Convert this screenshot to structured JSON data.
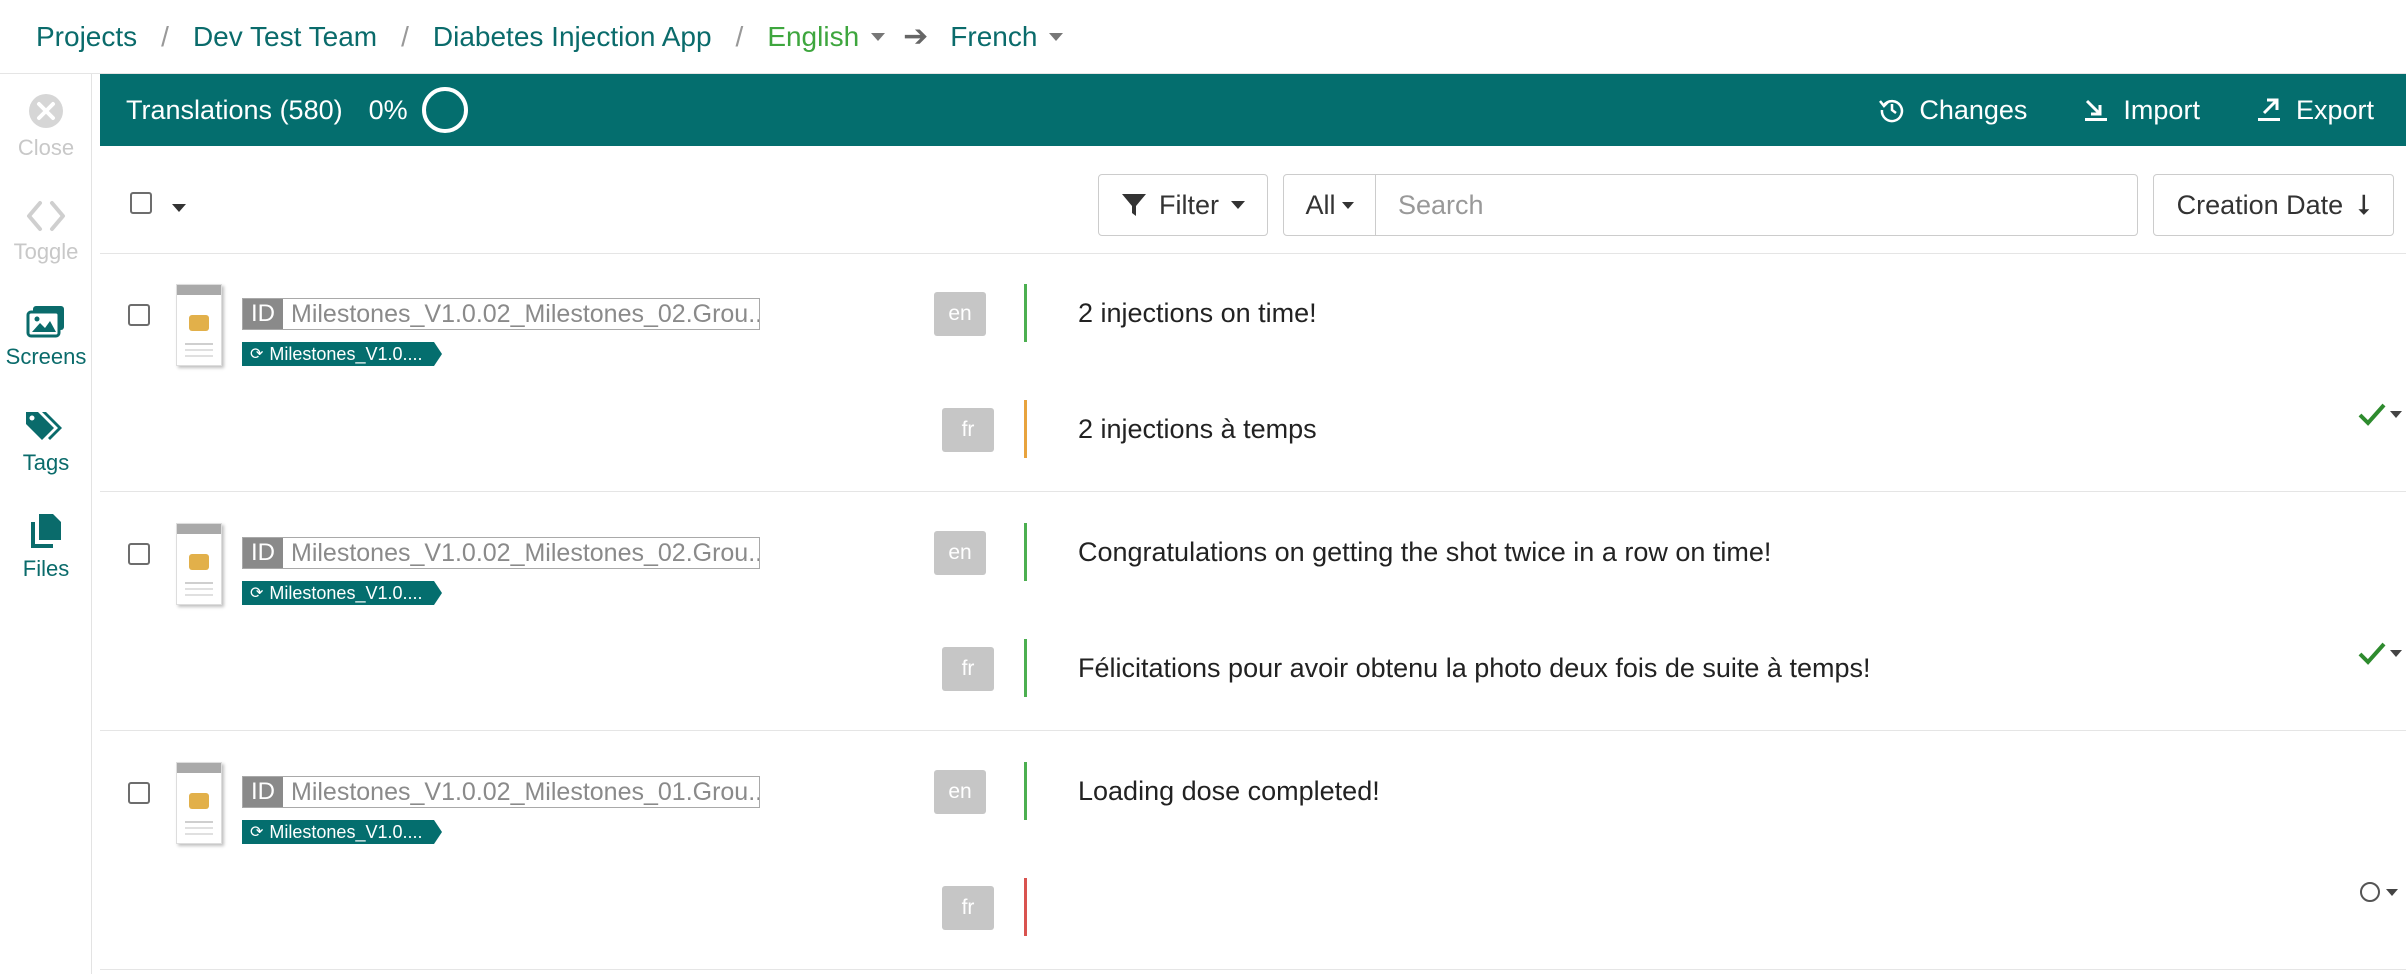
{
  "breadcrumb": {
    "projects": "Projects",
    "team": "Dev Test Team",
    "app": "Diabetes Injection App",
    "source_lang": "English",
    "target_lang": "French",
    "separator": "/"
  },
  "sidebar": {
    "close": "Close",
    "toggle": "Toggle",
    "screens": "Screens",
    "tags": "Tags",
    "files": "Files"
  },
  "header": {
    "title": "Translations (580)",
    "percent_label": "0%",
    "progress": 0,
    "changes": "Changes",
    "import": "Import",
    "export": "Export"
  },
  "toolbar": {
    "filter": "Filter",
    "scope": "All",
    "search_placeholder": "Search",
    "sort": "Creation Date",
    "sort_arrow": "⭣"
  },
  "rows": [
    {
      "id_badge": "ID",
      "key": "Milestones_V1.0.02_Milestones_02.Grou...",
      "tag": "Milestones_V1.0....",
      "source_lang": "en",
      "source_text": "2 injections on time!",
      "target_lang": "fr",
      "target_text": "2 injections à temps",
      "status": "approved"
    },
    {
      "id_badge": "ID",
      "key": "Milestones_V1.0.02_Milestones_02.Grou...",
      "tag": "Milestones_V1.0....",
      "source_lang": "en",
      "source_text": "Congratulations on getting the shot twice in a row on time!",
      "target_lang": "fr",
      "target_text": "Félicitations pour avoir obtenu la photo deux fois de suite à temps!",
      "status": "approved"
    },
    {
      "id_badge": "ID",
      "key": "Milestones_V1.0.02_Milestones_01.Grou...",
      "tag": "Milestones_V1.0....",
      "source_lang": "en",
      "source_text": "Loading dose completed!",
      "target_lang": "fr",
      "target_text": "",
      "status": "untranslated"
    }
  ],
  "colors": {
    "brand": "#046e6e",
    "link": "#0a6b6b",
    "source_lang": "#3ea63e",
    "bar_source": "#4caf50",
    "bar_target_done": "#e8a33d",
    "bar_target_missing": "#d9534f",
    "check": "#2e8b2e"
  },
  "icons": {
    "close": "close-circle-icon",
    "toggle": "code-brackets-icon",
    "screens": "images-icon",
    "tags": "tags-icon",
    "files": "files-icon",
    "changes": "history-icon",
    "import": "import-icon",
    "export": "export-icon",
    "filter": "funnel-icon",
    "sort": "arrow-down-icon",
    "tag": "sync-icon"
  }
}
